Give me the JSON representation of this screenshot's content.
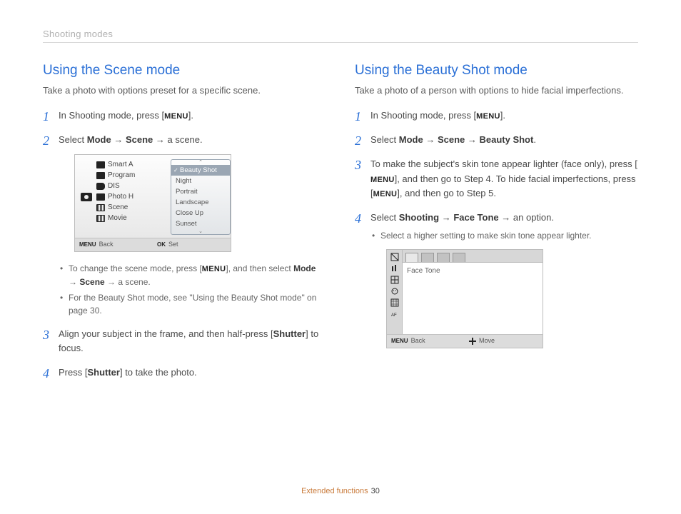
{
  "breadcrumb": "Shooting modes",
  "left": {
    "heading": "Using the Scene mode",
    "intro": "Take a photo with options preset for a specific scene.",
    "step1_pre": "In Shooting mode, press [",
    "menu_label": "MENU",
    "step1_post": "].",
    "step2_pre": "Select ",
    "step2_b1": "Mode",
    "step2_arrow": " → ",
    "step2_b2": "Scene",
    "step2_post": " → a scene.",
    "mid_items": [
      "Smart A",
      "Program",
      "DIS",
      "Photo H",
      "Scene",
      "Movie"
    ],
    "popup_items": [
      "Beauty Shot",
      "Night",
      "Portrait",
      "Landscape",
      "Close Up",
      "Sunset"
    ],
    "footer_back": "Back",
    "footer_set": "Set",
    "footer_ok": "OK",
    "note1_pre": "To change the scene mode, press [",
    "note1_post": "], and then select ",
    "note1_b1": "Mode",
    "note1_b2": "Scene",
    "note1_end": " → a scene.",
    "note2": "For the Beauty Shot mode, see \"Using the Beauty Shot mode\" on page 30.",
    "step3_pre": "Align your subject in the frame, and then half-press [",
    "step3_b": "Shutter",
    "step3_post": "] to focus.",
    "step4_pre": "Press [",
    "step4_b": "Shutter",
    "step4_post": "] to take the photo."
  },
  "right": {
    "heading": "Using the Beauty Shot mode",
    "intro": "Take a photo of a person with options to hide facial imperfections.",
    "step1_pre": "In Shooting mode, press [",
    "step1_post": "].",
    "step2_pre": "Select ",
    "step2_b1": "Mode",
    "step2_b2": "Scene",
    "step2_b3": "Beauty Shot",
    "step2_dot": ".",
    "step3_a": "To make the subject's skin tone appear lighter (face only), press [",
    "step3_b": "], and then go to Step 4. To hide facial imperfections, press [",
    "step3_c": "], and then go to Step 5.",
    "step4_pre": "Select ",
    "step4_b1": "Shooting",
    "step4_b2": "Face Tone",
    "step4_post": " → an option.",
    "step4_note": "Select a higher setting to make skin tone appear lighter.",
    "ft_label": "Face Tone",
    "ft_back": "Back",
    "ft_move": "Move"
  },
  "footer": {
    "section": "Extended functions",
    "page": "30"
  }
}
